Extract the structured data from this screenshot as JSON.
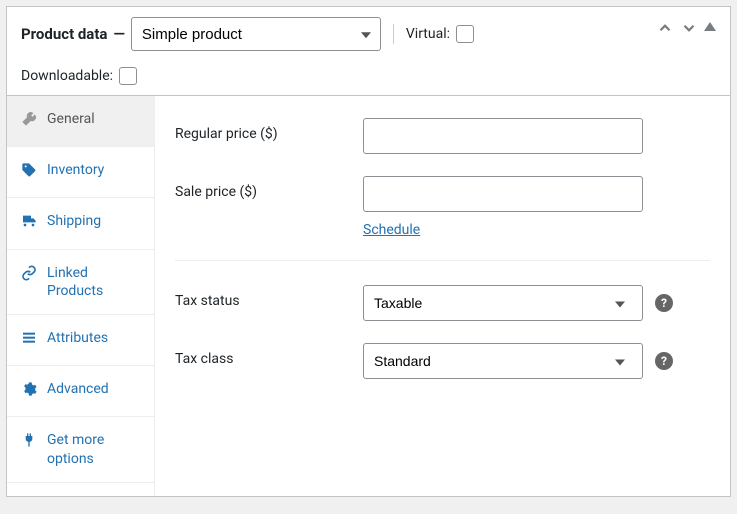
{
  "header": {
    "title": "Product data",
    "dash": "—",
    "product_type": "Simple product",
    "virtual_label": "Virtual:",
    "downloadable_label": "Downloadable:"
  },
  "sidebar": {
    "tabs": [
      {
        "label": "General"
      },
      {
        "label": "Inventory"
      },
      {
        "label": "Shipping"
      },
      {
        "label": "Linked Products"
      },
      {
        "label": "Attributes"
      },
      {
        "label": "Advanced"
      },
      {
        "label": "Get more options"
      }
    ]
  },
  "form": {
    "regular_price_label": "Regular price ($)",
    "regular_price_value": "",
    "sale_price_label": "Sale price ($)",
    "sale_price_value": "",
    "schedule_label": "Schedule",
    "tax_status_label": "Tax status",
    "tax_status_value": "Taxable",
    "tax_class_label": "Tax class",
    "tax_class_value": "Standard"
  }
}
